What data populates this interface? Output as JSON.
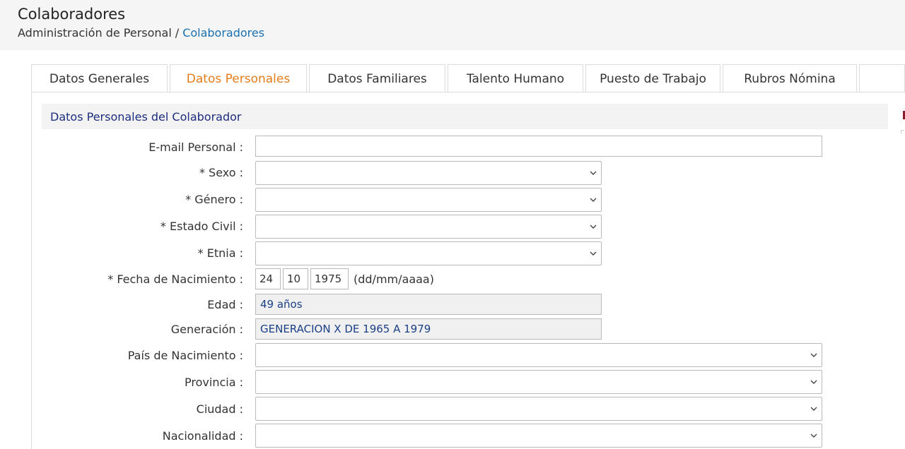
{
  "header": {
    "title": "Colaboradores",
    "breadcrumb_parent": "Administración de Personal",
    "breadcrumb_sep": "/",
    "breadcrumb_current": "Colaboradores"
  },
  "tabs": [
    {
      "label": "Datos Generales",
      "active": false
    },
    {
      "label": "Datos Personales",
      "active": true
    },
    {
      "label": "Datos Familiares",
      "active": false
    },
    {
      "label": "Talento Humano",
      "active": false
    },
    {
      "label": "Puesto de Trabajo",
      "active": false
    },
    {
      "label": "Rubros Nómina",
      "active": false
    },
    {
      "label": "",
      "active": false
    }
  ],
  "section": {
    "title": "Datos Personales del Colaborador"
  },
  "form": {
    "email_label": "E-mail Personal :",
    "email_value": "",
    "sexo_label": "* Sexo :",
    "sexo_value": "",
    "genero_label": "* Género :",
    "genero_value": "",
    "estado_civil_label": "* Estado Civil :",
    "estado_civil_value": "",
    "etnia_label": "* Etnia :",
    "etnia_value": "",
    "fecha_label": "* Fecha de Nacimiento :",
    "fecha_day": "24",
    "fecha_month": "10",
    "fecha_year": "1975",
    "fecha_hint": "(dd/mm/aaaa)",
    "edad_label": "Edad :",
    "edad_value": "49 años",
    "generacion_label": "Generación :",
    "generacion_value": "GENERACION X DE 1965 A 1979",
    "pais_label": "País de Nacimiento :",
    "pais_value": "",
    "provincia_label": "Provincia :",
    "provincia_value": "",
    "ciudad_label": "Ciudad :",
    "ciudad_value": "",
    "nacionalidad_label": "Nacionalidad :",
    "nacionalidad_value": ""
  },
  "colors": {
    "accent_tab": "#e57d1c",
    "breadcrumb_link": "#1a6fb0",
    "section_title": "#1d2d7f",
    "readonly_text": "#1a3f85"
  }
}
